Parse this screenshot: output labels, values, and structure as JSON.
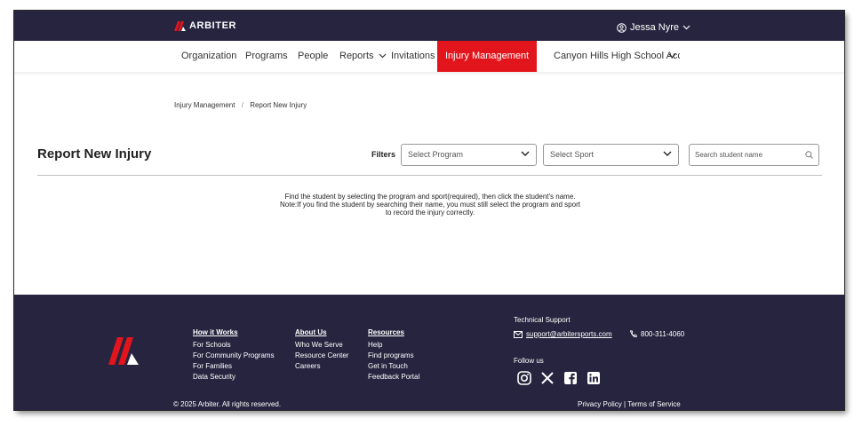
{
  "header": {
    "brand": "ARBITER",
    "user_name": "Jessa Nyre"
  },
  "nav": {
    "items": [
      {
        "label": "Organization"
      },
      {
        "label": "Programs"
      },
      {
        "label": "People"
      },
      {
        "label": "Reports"
      },
      {
        "label": "Invitations"
      },
      {
        "label": "Injury Management",
        "active": true
      },
      {
        "label": "Canyon Hills High School Acco"
      }
    ]
  },
  "breadcrumb": {
    "items": [
      "Injury Management",
      "Report New Injury"
    ],
    "separator": "/"
  },
  "page": {
    "title": "Report New Injury",
    "filters_label": "Filters",
    "program_select": "Select Program",
    "sport_select": "Select Sport",
    "search_placeholder": "Search student name",
    "instruction_line1": "Find the student by selecting the program and sport(required), then click the student's name.",
    "instruction_line2": "Note:If you find the student by searching their name, you must still select the program and sport",
    "instruction_line3": "to record the injury correctly."
  },
  "footer": {
    "how_it_works": {
      "heading": "How it Works",
      "links": [
        "For Schools",
        "For Community Programs",
        "For Families",
        "Data Security"
      ]
    },
    "about_us": {
      "heading": "About Us",
      "links": [
        "Who We Serve",
        "Resource Center",
        "Careers"
      ]
    },
    "resources": {
      "heading": "Resources",
      "links": [
        "Help",
        "Find programs",
        "Get in Touch",
        "Feedback Portal"
      ]
    },
    "support_title": "Technical Support",
    "support_email": "support@arbitersports.com",
    "support_phone": "800-311-4060",
    "follow_label": "Follow us",
    "socials": [
      "instagram-icon",
      "x-icon",
      "facebook-icon",
      "linkedin-icon"
    ],
    "copyright": "© 2025 Arbiter. All rights reserved.",
    "privacy": "Privacy Policy",
    "terms": "Terms of Service"
  },
  "colors": {
    "navy": "#27243f",
    "brand_red": "#e3151c"
  }
}
